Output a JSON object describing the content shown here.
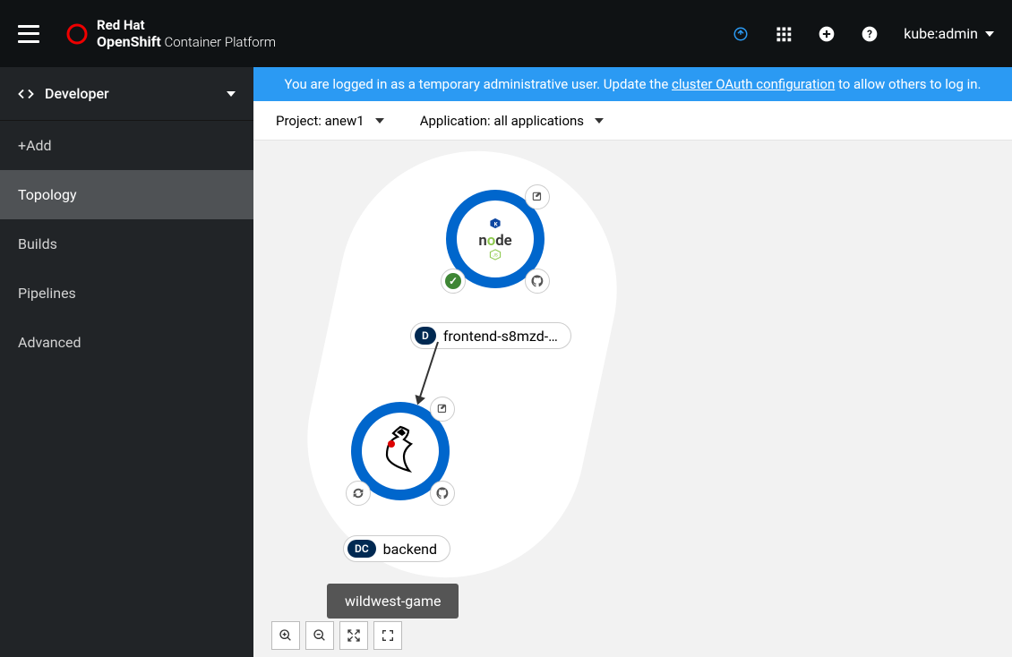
{
  "header": {
    "brand": "Red Hat",
    "product_strong": "OpenShift",
    "product_rest": " Container Platform",
    "user": "kube:admin"
  },
  "sidebar": {
    "perspective": "Developer",
    "items": [
      "+Add",
      "Topology",
      "Builds",
      "Pipelines",
      "Advanced"
    ],
    "active_index": 1
  },
  "banner": {
    "prefix": "You are logged in as a temporary administrative user. Update the ",
    "link": "cluster OAuth configuration",
    "suffix": " to allow others to log in."
  },
  "selectors": {
    "project_label": "Project: ",
    "project_value": "anew1",
    "app_label": "Application: ",
    "app_value": "all applications"
  },
  "topology": {
    "group_label": "wildwest-game",
    "nodes": [
      {
        "badge": "D",
        "label": "frontend-s8mzd-…",
        "runtime": "nodejs"
      },
      {
        "badge": "DC",
        "label": "backend",
        "runtime": "java"
      }
    ]
  }
}
